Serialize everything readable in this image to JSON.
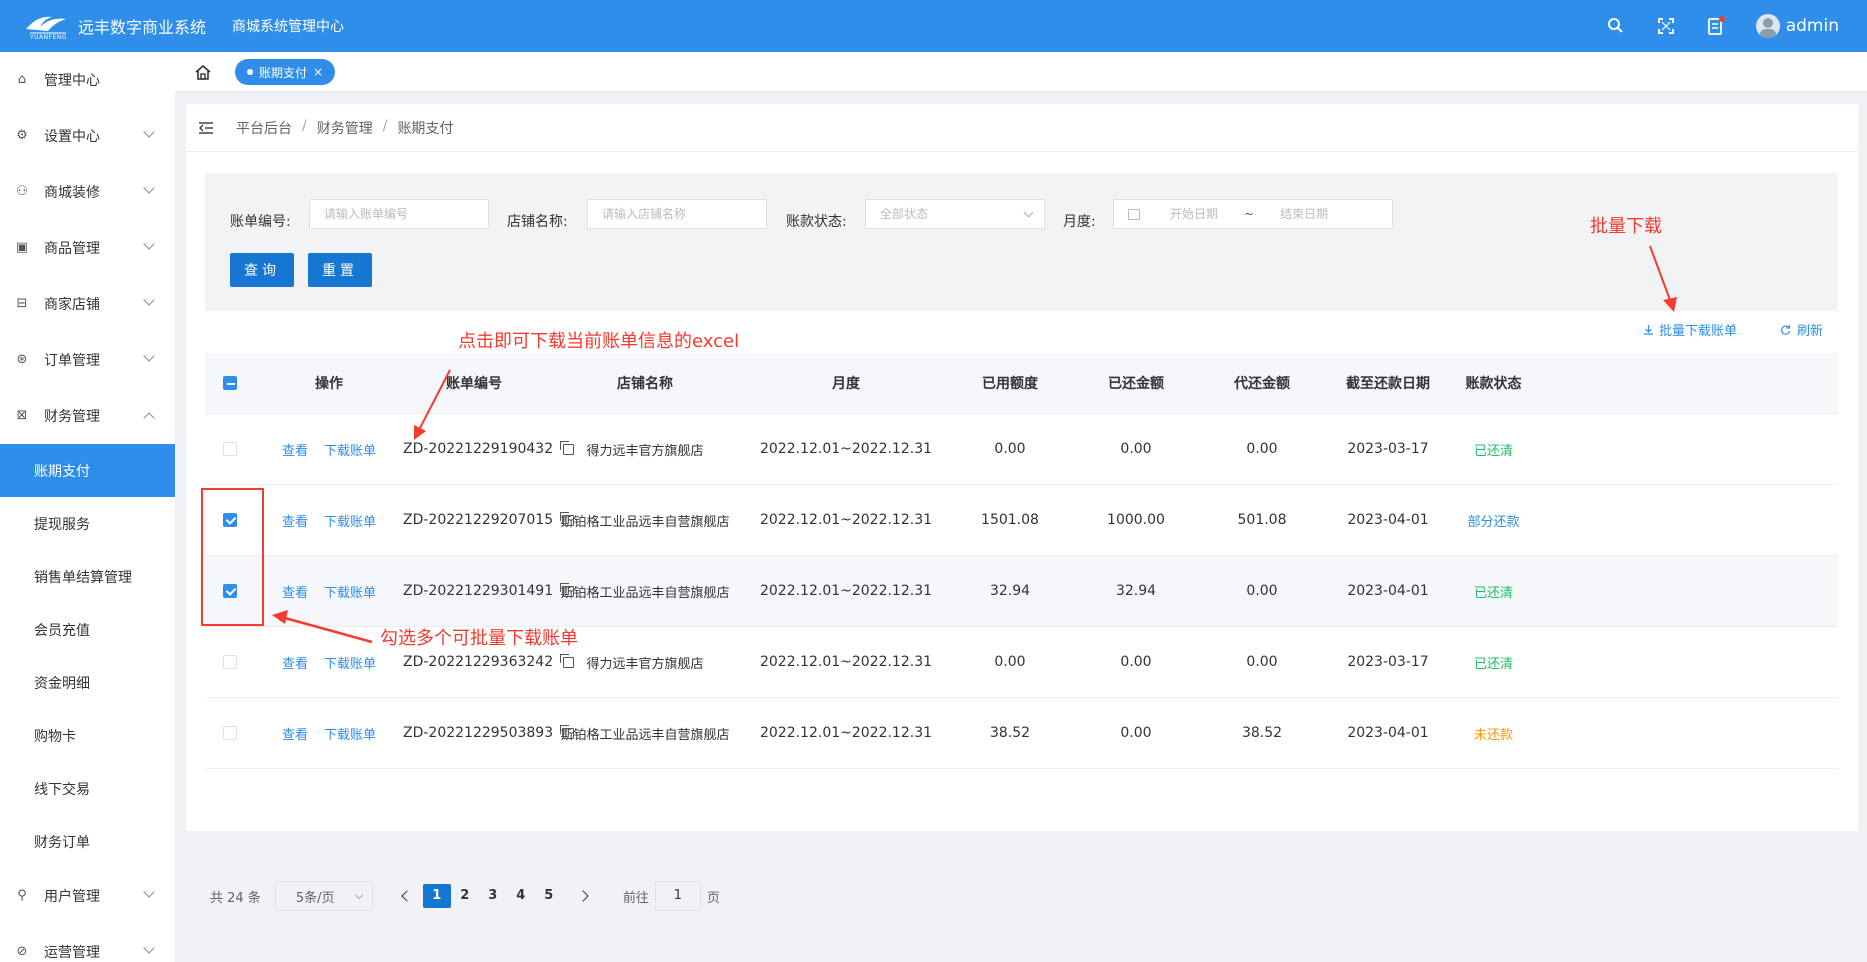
{
  "header": {
    "brand": "远丰数字商业系统",
    "logo_text": "YUANFENG",
    "system": "商城系统管理中心",
    "user": "admin",
    "icons": [
      "search-icon",
      "fullscreen-icon",
      "notice-icon"
    ]
  },
  "sidebar": {
    "items": [
      {
        "label": "管理中心",
        "icon": "home-icon",
        "expand": false
      },
      {
        "label": "设置中心",
        "icon": "gear-icon",
        "expand": true
      },
      {
        "label": "商城装修",
        "icon": "users-icon",
        "expand": true
      },
      {
        "label": "商品管理",
        "icon": "goods-icon",
        "expand": true
      },
      {
        "label": "商家店铺",
        "icon": "store-icon",
        "expand": true
      },
      {
        "label": "订单管理",
        "icon": "order-icon",
        "expand": true
      },
      {
        "label": "财务管理",
        "icon": "finance-icon",
        "expand": true
      }
    ],
    "sub": [
      "账期支付",
      "提现服务",
      "销售单结算管理",
      "会员充值",
      "资金明细",
      "购物卡",
      "线下交易",
      "财务订单"
    ],
    "after": [
      {
        "label": "用户管理",
        "icon": "user-icon"
      },
      {
        "label": "运营管理",
        "icon": "ops-icon"
      }
    ]
  },
  "tabs": {
    "active": "账期支付",
    "close": "×"
  },
  "breadcrumb": [
    "平台后台",
    "财务管理",
    "账期支付"
  ],
  "breadcrumb_sep": "/",
  "filter": {
    "bill_no_label": "账单编号:",
    "bill_no_ph": "请输入账单编号",
    "shop_label": "店铺名称:",
    "shop_ph": "请输入店铺名称",
    "status_label": "账款状态:",
    "status_value": "全部状态",
    "month_label": "月度:",
    "start_ph": "开始日期",
    "tilde": "~",
    "end_ph": "结束日期",
    "query": "查询",
    "reset": "重置"
  },
  "toolbar": {
    "batch": "批量下载账单",
    "refresh": "刷新"
  },
  "table": {
    "headers": [
      "操作",
      "账单编号",
      "店铺名称",
      "月度",
      "已用额度",
      "已还金额",
      "代还金额",
      "截至还款日期",
      "账款状态"
    ],
    "view": "查看",
    "download": "下载账单",
    "rows": [
      {
        "checked": false,
        "no": "ZD-20221229190432",
        "shop": "得力远丰官方旗舰店",
        "month": "2022.12.01~2022.12.31",
        "used": "0.00",
        "paid": "0.00",
        "due": "0.00",
        "date": "2023-03-17",
        "status": "已还清",
        "color": "#19be6b"
      },
      {
        "checked": true,
        "no": "ZD-20221229207015",
        "shop": "斯铂格工业品远丰自营旗舰店",
        "month": "2022.12.01~2022.12.31",
        "used": "1501.08",
        "paid": "1000.00",
        "due": "501.08",
        "date": "2023-04-01",
        "status": "部分还款",
        "color": "#2f8ee9"
      },
      {
        "checked": true,
        "no": "ZD-20221229301491",
        "shop": "斯铂格工业品远丰自营旗舰店",
        "month": "2022.12.01~2022.12.31",
        "used": "32.94",
        "paid": "32.94",
        "due": "0.00",
        "date": "2023-04-01",
        "status": "已还清",
        "color": "#19be6b"
      },
      {
        "checked": false,
        "no": "ZD-20221229363242",
        "shop": "得力远丰官方旗舰店",
        "month": "2022.12.01~2022.12.31",
        "used": "0.00",
        "paid": "0.00",
        "due": "0.00",
        "date": "2023-03-17",
        "status": "已还清",
        "color": "#19be6b"
      },
      {
        "checked": false,
        "no": "ZD-20221229503893",
        "shop": "斯铂格工业品远丰自营旗舰店",
        "month": "2022.12.01~2022.12.31",
        "used": "38.52",
        "paid": "0.00",
        "due": "38.52",
        "date": "2023-04-01",
        "status": "未还款",
        "color": "#ff9900"
      }
    ]
  },
  "pagination": {
    "total": "共 24 条",
    "size": "5条/页",
    "pages": [
      "1",
      "2",
      "3",
      "4",
      "5"
    ],
    "current": "1",
    "goto": "前往",
    "page_value": "1",
    "page_suffix": "页"
  },
  "annotations": {
    "batch": "批量下载",
    "excel": "点击即可下载当前账单信息的excel",
    "multi": "勾选多个可批量下载账单"
  }
}
